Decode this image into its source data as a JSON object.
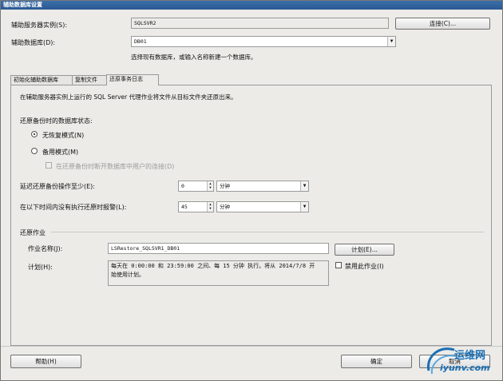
{
  "window": {
    "title": "辅助数据库设置"
  },
  "secondary_instance": {
    "label": "辅助服务器实例(S):",
    "value": "SQLSVR2"
  },
  "connect_button": "连接(C)...",
  "secondary_db": {
    "label": "辅助数据库(D):",
    "value": "DB01",
    "hint": "选择现有数据库，或输入名称新建一个数据库。"
  },
  "tabs": [
    {
      "label": "初始化辅助数据库"
    },
    {
      "label": "复制文件"
    },
    {
      "label": "还原事务日志"
    }
  ],
  "restore_tab": {
    "description": "在辅助服务器实例上运行的 SQL Server 代理作业将文件从目标文件夹还原出来。",
    "state_label": "还原备份时的数据库状态:",
    "no_recovery": "无恢复模式(N)",
    "standby": "备用模式(M)",
    "disconnect": "在还原备份时断开数据库中用户的连接(D)",
    "delay_label": "延迟还原备份操作至少(E):",
    "delay_value": "0",
    "delay_unit": "分钟",
    "alert_label": "在以下时间内没有执行还原时报警(L):",
    "alert_value": "45",
    "alert_unit": "分钟",
    "job_group": "还原作业",
    "job_name_label": "作业名称(J):",
    "job_name": "LSRestore_SQLSVR1_DB01",
    "schedule_button": "计划(E)...",
    "schedule_label": "计划(H):",
    "schedule_line1": "每天在 0:00:00 和 23:59:00 之间、每 15 分钟 执行。将从 2014/7/8 开",
    "schedule_line2": "始使用计划。",
    "disable_job": "禁用此作业(I)"
  },
  "help_button": "帮助(H)",
  "ok_button": "确定",
  "cancel_button": "取消",
  "watermark": {
    "brand": "运维网",
    "url": "iyunv.com"
  },
  "colors": {
    "title_bar": "#2b5a92",
    "watermark": "#1a6fb5"
  }
}
